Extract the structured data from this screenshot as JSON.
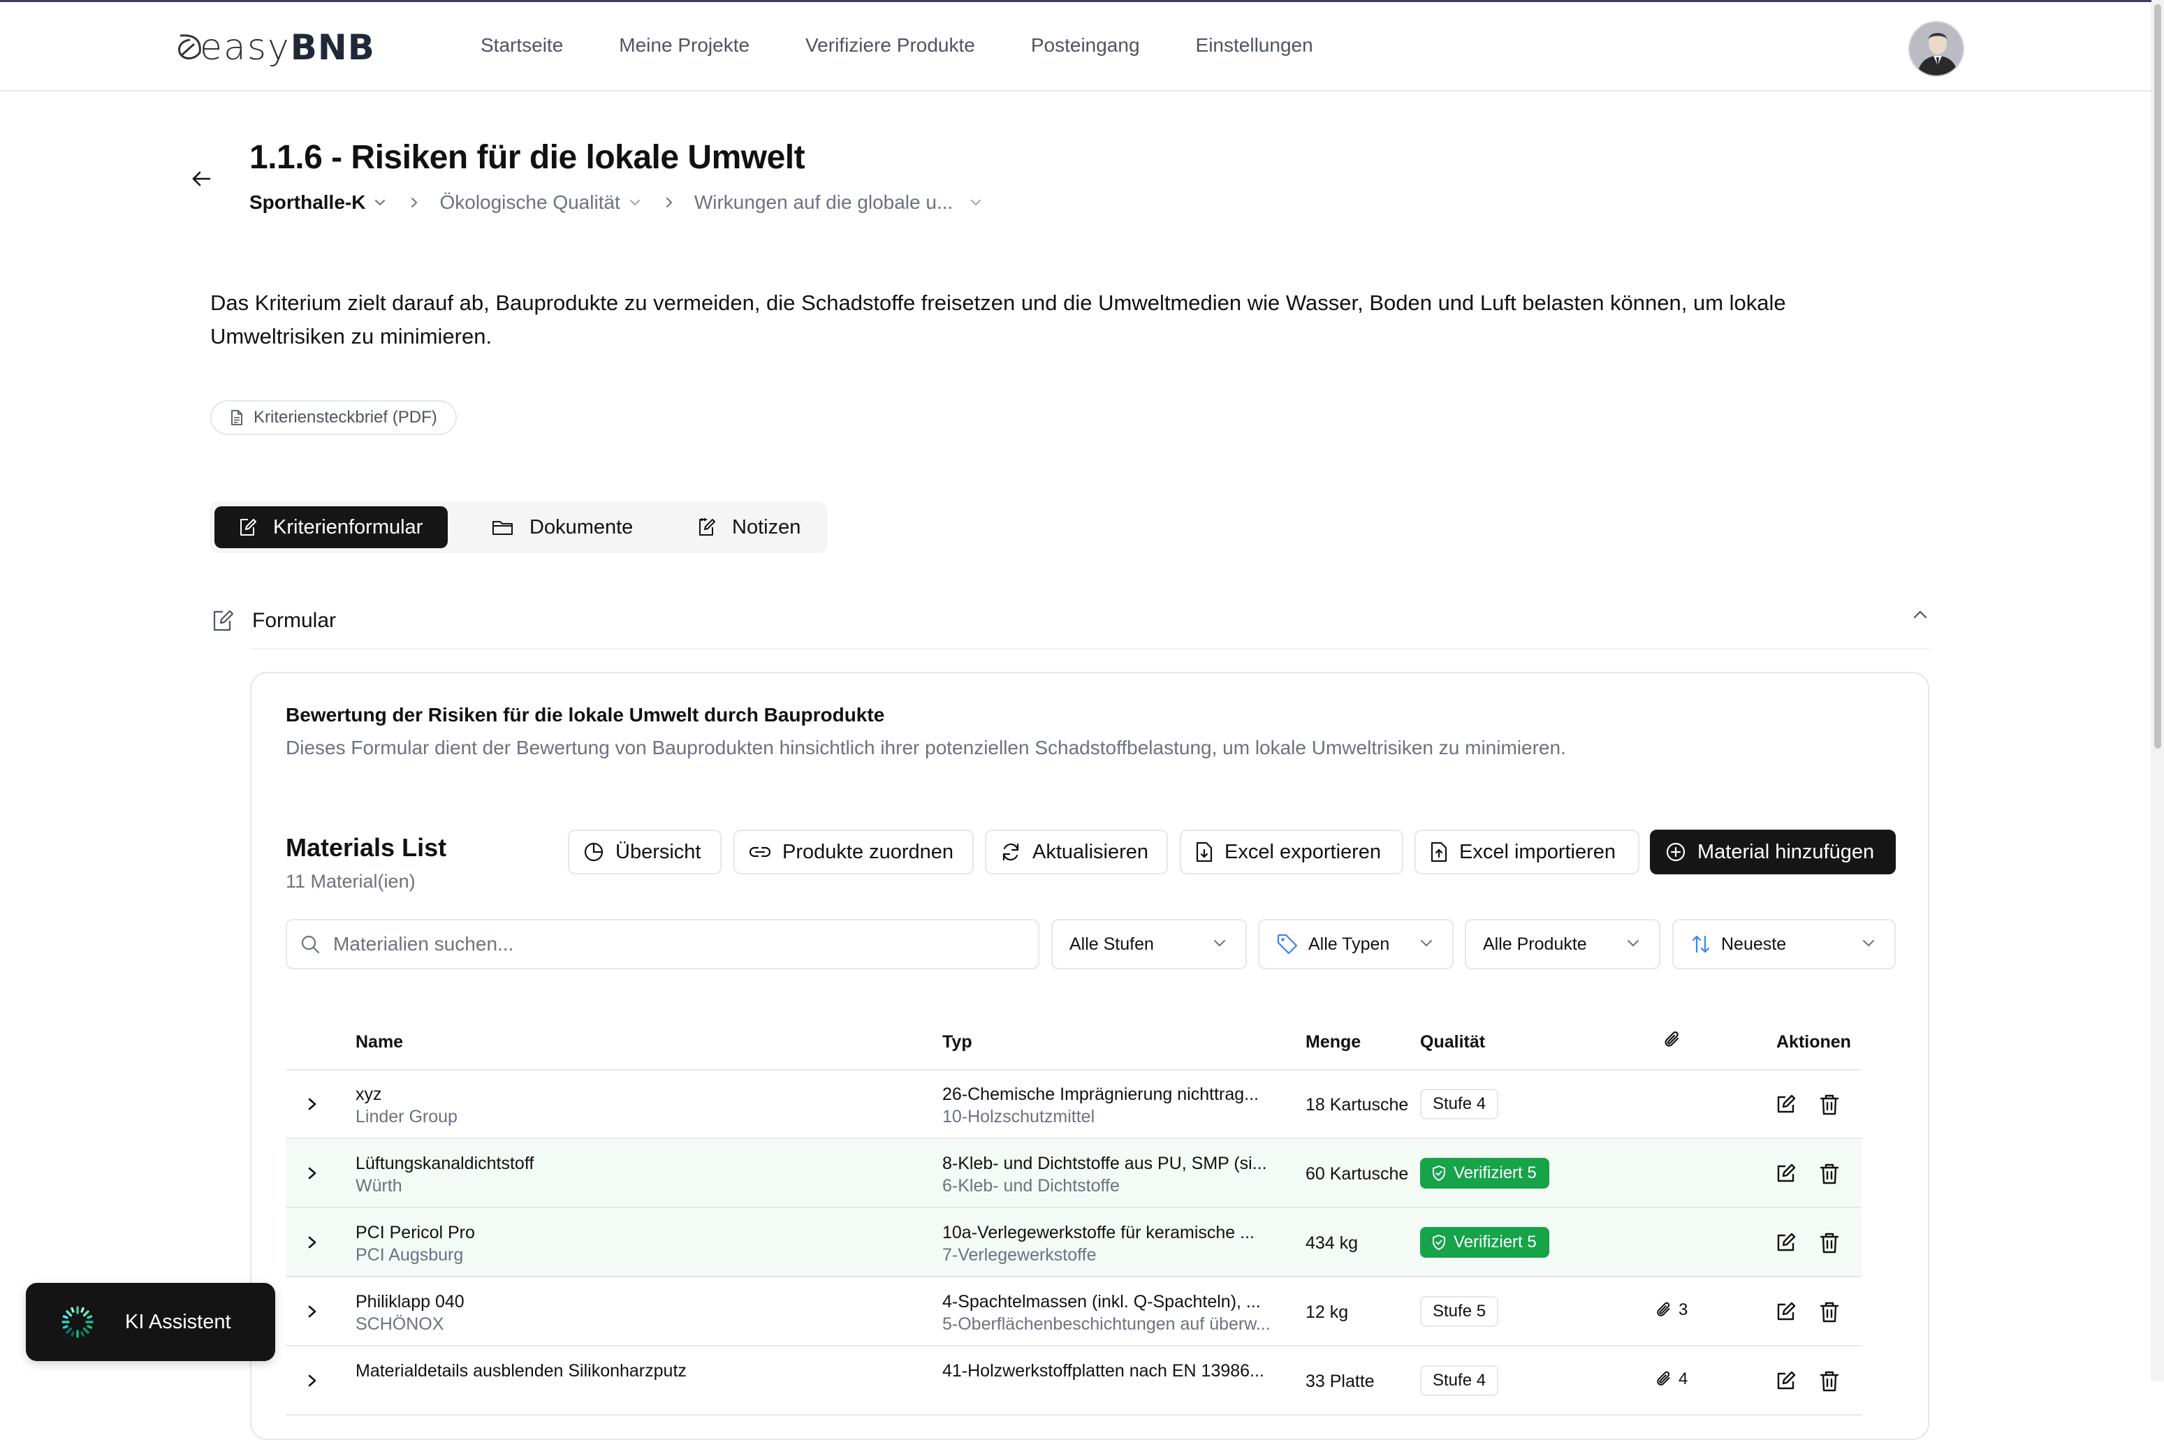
{
  "brand": {
    "logo_light": "easy",
    "logo_bold": "BNB"
  },
  "nav": {
    "items": [
      {
        "label": "Startseite"
      },
      {
        "label": "Meine Projekte"
      },
      {
        "label": "Verifiziere Produkte"
      },
      {
        "label": "Posteingang"
      },
      {
        "label": "Einstellungen"
      }
    ]
  },
  "header": {
    "title": "1.1.6 - Risiken für die lokale Umwelt",
    "breadcrumb": [
      "Sporthalle-K",
      "Ökologische Qualität",
      "Wirkungen auf die globale u..."
    ]
  },
  "description": "Das Kriterium zielt darauf ab, Bauprodukte zu vermeiden, die Schadstoffe freisetzen und die Umweltmedien wie Wasser, Boden und Luft belasten können, um lokale Umweltrisiken zu minimieren.",
  "pdf_chip": "Kriteriensteckbrief (PDF)",
  "tabs": [
    {
      "label": "Kriterienformular",
      "icon": "form-edit-icon",
      "active": true
    },
    {
      "label": "Dokumente",
      "icon": "folder-icon",
      "active": false
    },
    {
      "label": "Notizen",
      "icon": "notes-icon",
      "active": false
    }
  ],
  "section": {
    "title": "Formular"
  },
  "form": {
    "title": "Bewertung der Risiken für die lokale Umwelt durch Bauprodukte",
    "subtitle": "Dieses Formular dient der Bewertung von Bauprodukten hinsichtlich ihrer potenziellen Schadstoffbelastung, um lokale Umweltrisiken zu minimieren."
  },
  "materials": {
    "title": "Materials List",
    "count": "11 Material(ien)",
    "buttons": {
      "overview": "Übersicht",
      "assign": "Produkte zuordnen",
      "refresh": "Aktualisieren",
      "export": "Excel exportieren",
      "import": "Excel importieren",
      "add": "Material hinzufügen"
    },
    "search_placeholder": "Materialien suchen...",
    "filters": {
      "levels": "Alle Stufen",
      "types": "Alle Typen",
      "products": "Alle Produkte",
      "sort": "Neueste"
    },
    "columns": {
      "name": "Name",
      "typ": "Typ",
      "menge": "Menge",
      "qualitaet": "Qualität",
      "aktionen": "Aktionen"
    },
    "rows": [
      {
        "name": "xyz",
        "manufacturer": "Linder Group",
        "typ": "26-Chemische Imprägnierung nichttrag...",
        "typ_sub": "10-Holzschutzmittel",
        "menge": "18 Kartusche",
        "quality": "Stufe 4",
        "verified": false,
        "attachments": ""
      },
      {
        "name": "Lüftungskanaldichtstoff",
        "manufacturer": "Würth",
        "typ": "8-Kleb- und Dichtstoffe aus PU, SMP (si...",
        "typ_sub": "6-Kleb- und Dichtstoffe",
        "menge": "60 Kartusche",
        "quality": "Verifiziert 5",
        "verified": true,
        "attachments": ""
      },
      {
        "name": "PCI Pericol Pro",
        "manufacturer": "PCI Augsburg",
        "typ": "10a-Verlegewerkstoffe für keramische ...",
        "typ_sub": "7-Verlegewerkstoffe",
        "menge": "434 kg",
        "quality": "Verifiziert 5",
        "verified": true,
        "attachments": ""
      },
      {
        "name": "Philiklapp 040",
        "manufacturer": "SCHÖNOX",
        "typ": "4-Spachtelmassen (inkl. Q-Spachteln), ...",
        "typ_sub": "5-Oberflächenbeschichtungen auf überw...",
        "menge": "12 kg",
        "quality": "Stufe 5",
        "verified": false,
        "attachments": "3"
      },
      {
        "name": "Materialdetails ausblenden Silikonharzputz",
        "manufacturer": "",
        "typ": "41-Holzwerkstoffplatten nach EN 13986...",
        "typ_sub": "",
        "menge": "33 Platte",
        "quality": "Stufe 4",
        "verified": false,
        "attachments": "4"
      }
    ]
  },
  "assistant": {
    "label": "KI Assistent"
  },
  "colors": {
    "accent_dark": "#161616",
    "verified_green": "#16a34a",
    "row_highlight": "#f4faf6"
  }
}
